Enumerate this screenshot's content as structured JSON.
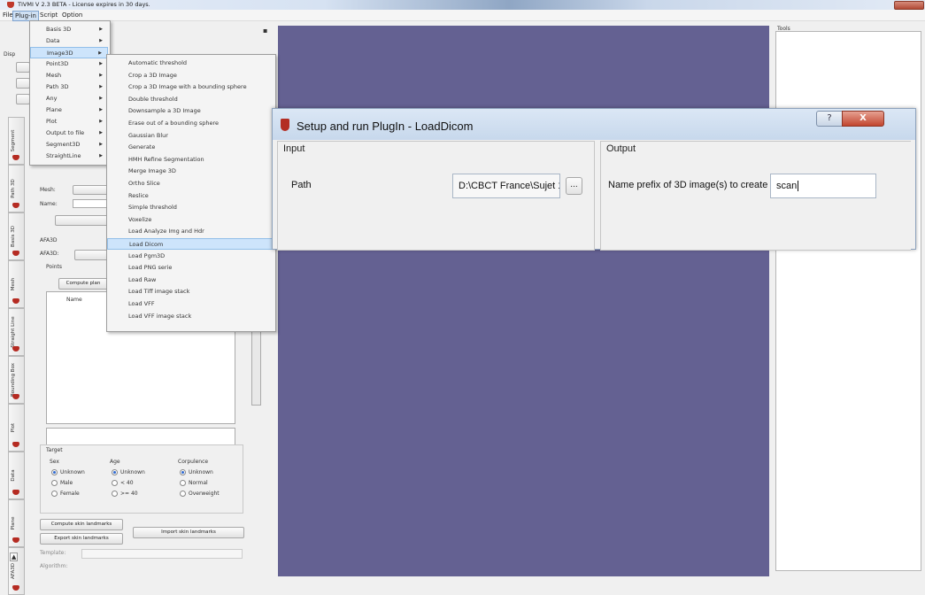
{
  "window": {
    "title": "TIVMI V 2.3 BETA - License expires in 30 days."
  },
  "menubar": {
    "items": [
      "File",
      "Plug-in",
      "Script",
      "Option"
    ]
  },
  "dock": {
    "header_label": "Disp",
    "vertical_tabs": [
      "Segment",
      "Path 3D",
      "Basis 3D",
      "Mesh",
      "Straight Line",
      "Bounding Box",
      "Plot",
      "Data",
      "Plane",
      "AFA3D"
    ],
    "mesh_label": "Mesh:",
    "name_label": "Name:",
    "afa3d_section": "AFA3D",
    "afa3d_label": "AFA3D:",
    "points_label": "Points",
    "compute_plane_button": "Compute plan",
    "points_col_name": "Name",
    "target_label": "Target",
    "sex": {
      "title": "Sex",
      "options": [
        "Unknown",
        "Male",
        "Female"
      ]
    },
    "age": {
      "title": "Age",
      "options": [
        "Unknown",
        "< 40",
        ">= 40"
      ]
    },
    "corpulence": {
      "title": "Corpulence",
      "options": [
        "Unknown",
        "Normal",
        "Overweight"
      ]
    },
    "compute_skin_button": "Compute skin landmarks",
    "export_skin_button": "Export skin landmarks",
    "import_skin_button": "Import skin landmarks",
    "template_label": "Template:",
    "algorithm_label": "Algorithm:"
  },
  "plugin_menu": {
    "items": [
      {
        "label": "Basis 3D",
        "submenu": true
      },
      {
        "label": "Data",
        "submenu": true
      },
      {
        "label": "Image3D",
        "submenu": true
      },
      {
        "label": "Point3D",
        "submenu": true
      },
      {
        "label": "Mesh",
        "submenu": true
      },
      {
        "label": "Path 3D",
        "submenu": true
      },
      {
        "label": "Any",
        "submenu": true
      },
      {
        "label": "Plane",
        "submenu": true
      },
      {
        "label": "Plot",
        "submenu": true
      },
      {
        "label": "Output to file",
        "submenu": true
      },
      {
        "label": "Segment3D",
        "submenu": true
      },
      {
        "label": "StraightLine",
        "submenu": true
      }
    ],
    "active_index": 2
  },
  "image3d_submenu": {
    "items": [
      "Automatic threshold",
      "Crop a 3D Image",
      "Crop a 3D Image with a bounding sphere",
      "Double threshold",
      "Downsample a 3D Image",
      "Erase out of a bounding sphere",
      "Gaussian Blur",
      "Generate",
      "HMH Refine Segmentation",
      "Merge Image 3D",
      "Ortho Slice",
      "Reslice",
      "Simple threshold",
      "Voxelize",
      "Load Analyze Img and Hdr",
      "Load Dicom",
      "Load Pgm3D",
      "Load PNG serie",
      "Load Raw",
      "Load Tiff image stack",
      "Load VFF",
      "Load VFF image stack"
    ],
    "highlighted_index": 15
  },
  "tools_panel": {
    "title": "Tools"
  },
  "dialog": {
    "title": "Setup and run PlugIn - LoadDicom",
    "help_label": "?",
    "close_label": "X",
    "input_group": "Input",
    "path_label": "Path",
    "path_value": "D:\\CBCT France\\Sujet 1",
    "browse_label": "...",
    "output_group": "Output",
    "prefix_label": "Name prefix of 3D image(s) to create",
    "prefix_value": "scan"
  },
  "colors": {
    "view_background": "#646192",
    "menu_highlight": "#cde4fb",
    "brand_red": "#b32d23"
  }
}
